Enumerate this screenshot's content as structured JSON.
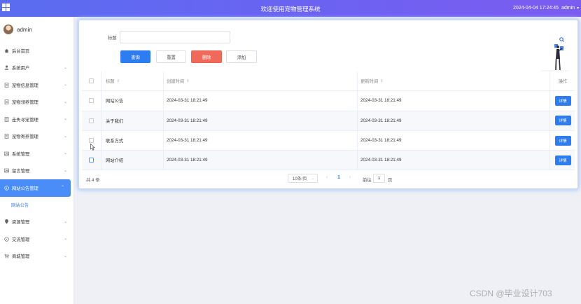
{
  "header": {
    "app_title": "欢迎使用宠物管理系统",
    "datetime": "2024-04-04 17:24:45",
    "user": "admin"
  },
  "sidebar": {
    "profile_name": "admin",
    "items": [
      {
        "label": "后台首页",
        "icon": "home-icon",
        "has_children": false
      },
      {
        "label": "系统用户",
        "icon": "user-icon",
        "has_children": true
      },
      {
        "label": "宠物信息管理",
        "icon": "document-icon",
        "has_children": true
      },
      {
        "label": "宠物领养管理",
        "icon": "document-icon",
        "has_children": true
      },
      {
        "label": "走失寻宠管理",
        "icon": "document-icon",
        "has_children": true
      },
      {
        "label": "宠物寄养管理",
        "icon": "document-icon",
        "has_children": true
      },
      {
        "label": "系统管理",
        "icon": "picture-icon",
        "has_children": true
      },
      {
        "label": "留言管理",
        "icon": "picture-icon",
        "has_children": true
      },
      {
        "label": "网站公告管理",
        "icon": "info-icon",
        "has_children": true,
        "active": true
      },
      {
        "label": "资源管理",
        "icon": "location-icon",
        "has_children": true
      },
      {
        "label": "交流管理",
        "icon": "compass-icon",
        "has_children": true
      },
      {
        "label": "商城管理",
        "icon": "cart-icon",
        "has_children": true
      }
    ],
    "sub_item": "网站公告"
  },
  "search": {
    "label": "标题",
    "value": "",
    "placeholder": ""
  },
  "buttons": {
    "query": "查询",
    "reset": "重置",
    "delete": "删除",
    "add": "添加"
  },
  "table": {
    "columns": [
      "标题",
      "创建时间",
      "更新时间",
      "操作"
    ],
    "rows": [
      {
        "title": "网站公告",
        "created": "2024-03-31 18:21:49",
        "updated": "2024-03-31 18:21:49",
        "action": "详情"
      },
      {
        "title": "关于我们",
        "created": "2024-03-31 18:21:49",
        "updated": "2024-03-31 18:21:49",
        "action": "详情"
      },
      {
        "title": "联系方式",
        "created": "2024-03-31 18:21:49",
        "updated": "2024-03-31 18:21:49",
        "action": "详情"
      },
      {
        "title": "网站介绍",
        "created": "2024-03-31 18:21:49",
        "updated": "2024-03-31 18:21:49",
        "action": "详情"
      }
    ]
  },
  "pagination": {
    "total": "共 4 条",
    "page_size": "10条/页",
    "current_page": "1",
    "goto_label": "前往",
    "goto_value": "1",
    "goto_suffix": "页"
  },
  "watermark": "CSDN @毕业设计703",
  "colors": {
    "primary": "#2d7cf0",
    "danger": "#f06a5b",
    "header_start": "#5a6df0",
    "header_end": "#7b5cf0",
    "active_nav": "#4b8df8"
  }
}
